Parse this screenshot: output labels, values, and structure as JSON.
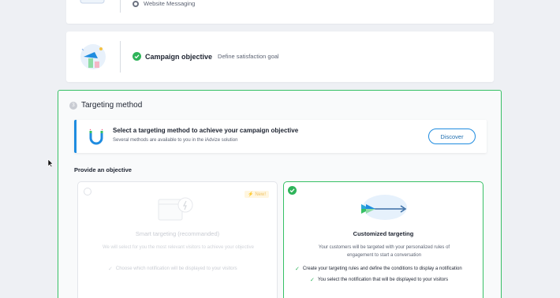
{
  "steps": {
    "website_messaging": {
      "label": "Website Messaging"
    },
    "campaign_objective": {
      "title": "Campaign objective",
      "subtitle": "Define satisfaction goal"
    }
  },
  "targeting": {
    "step_number": "3",
    "title": "Targeting method",
    "banner": {
      "title": "Select a targeting method to achieve your campaign objective",
      "subtitle": "Several methods are available to you in the iAdvize solution",
      "button_label": "Discover"
    },
    "provide_label": "Provide an objective",
    "options": [
      {
        "title": "Smart targeting (recommanded)",
        "badge": "New!",
        "description": "We will select for you the most relevant visitors to achieve your objective",
        "features": [
          "Choose which notification will be displayed to your visitors"
        ]
      },
      {
        "title": "Customized targeting",
        "description": "Your customers will be targeted with your personalized rules of engagement to start a conversation",
        "features": [
          "Create your targeting rules and define the conditions to display a notification",
          "You select the notification that will be displayed to your visitors"
        ]
      }
    ]
  },
  "colors": {
    "accent_blue": "#1f8ce0",
    "success_green": "#2fb45a",
    "panel_border": "#37c065"
  },
  "icons": [
    "radio-icon",
    "check-circle-icon",
    "magnet-icon",
    "lightning-icon",
    "arrow-target-icon",
    "checkmark-icon",
    "mouse-cursor-icon"
  ]
}
